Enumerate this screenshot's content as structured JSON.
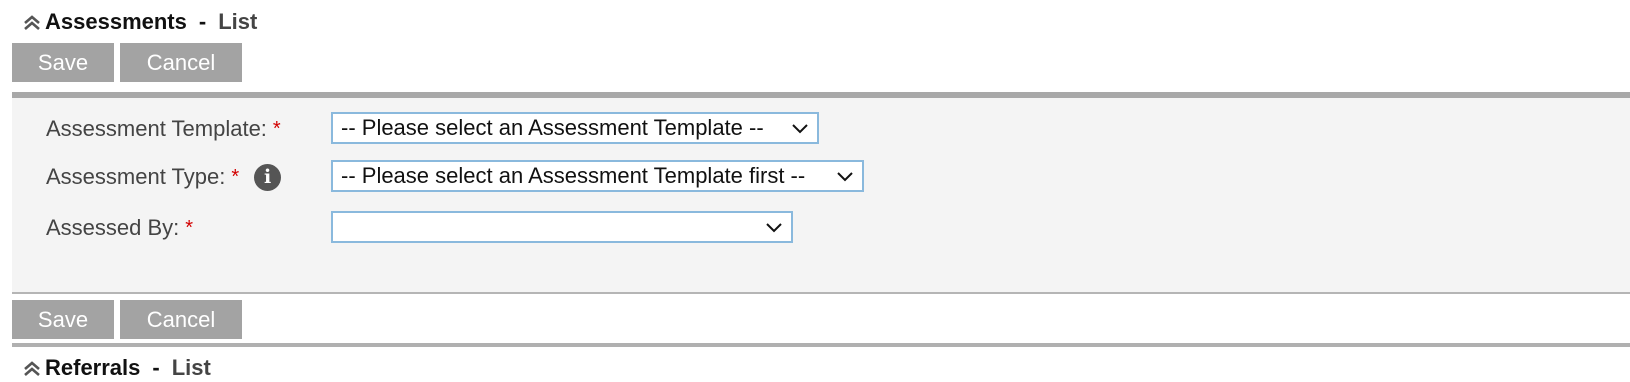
{
  "section": {
    "title": "Assessments",
    "separator": "-",
    "subtitle": "List",
    "collapse_icon": "chevron-double-up-icon"
  },
  "buttons": {
    "save_label": "Save",
    "cancel_label": "Cancel"
  },
  "form": {
    "fields": [
      {
        "label": "Assessment Template:",
        "required_marker": "*",
        "value": "-- Please select an Assessment Template --"
      },
      {
        "label": "Assessment Type:",
        "required_marker": "*",
        "info_icon": "i",
        "value": "-- Please select an Assessment Template first --"
      },
      {
        "label": "Assessed By:",
        "required_marker": "*",
        "value": ""
      }
    ]
  },
  "next_section": {
    "title": "Referrals",
    "separator": "-",
    "subtitle": "List"
  },
  "colors": {
    "button_bg": "#a3a3a3",
    "panel_bg": "#f4f4f4",
    "select_border": "#8ab9dd",
    "required": "#d20000"
  }
}
